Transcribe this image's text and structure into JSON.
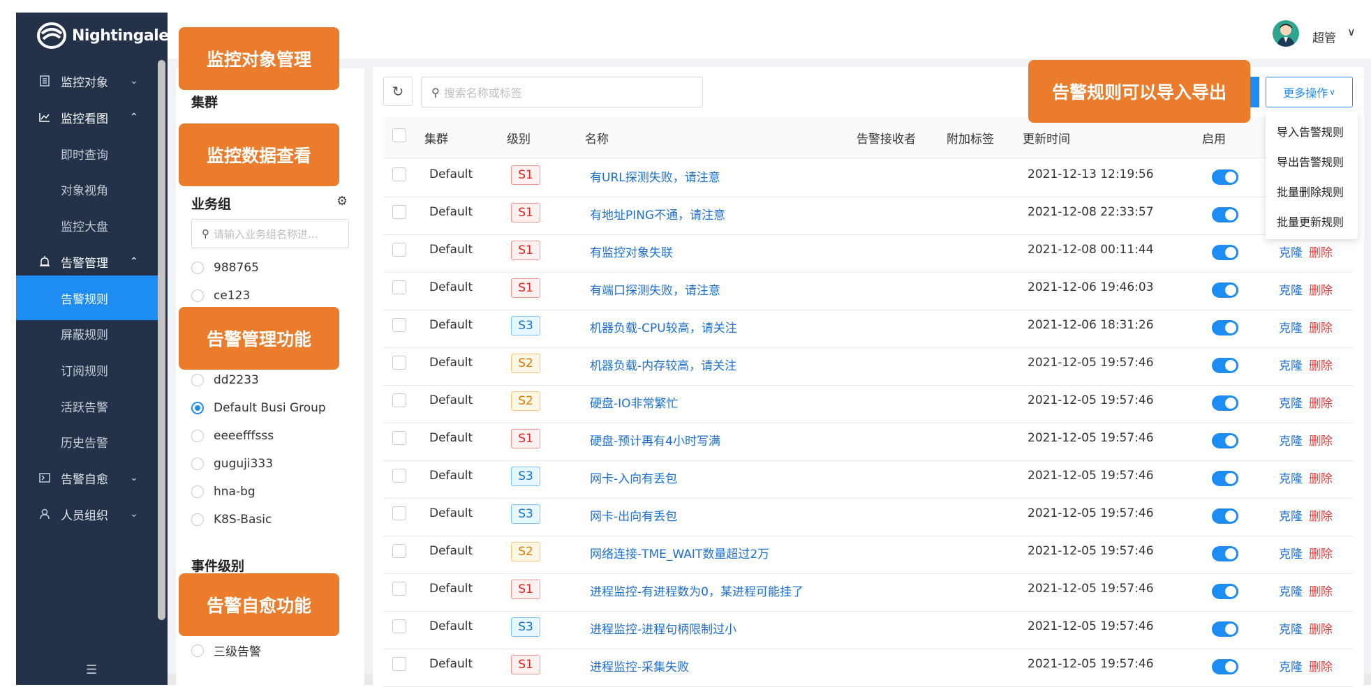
{
  "sidebar": {
    "logo_text": "Nightingale",
    "items": [
      {
        "label": "监控对象",
        "icon": "monitor-object-icon",
        "chevron": "⌄"
      },
      {
        "label": "监控看图",
        "icon": "chart-icon",
        "chevron": "⌃"
      },
      {
        "label": "即时查询"
      },
      {
        "label": "对象视角"
      },
      {
        "label": "监控大盘"
      },
      {
        "label": "告警管理",
        "icon": "alarm-icon",
        "chevron": "⌃"
      },
      {
        "label": "告警规则"
      },
      {
        "label": "屏蔽规则"
      },
      {
        "label": "订阅规则"
      },
      {
        "label": "活跃告警"
      },
      {
        "label": "历史告警"
      },
      {
        "label": "告警自愈",
        "icon": "terminal-icon",
        "chevron": "⌄"
      },
      {
        "label": "人员组织",
        "icon": "user-icon",
        "chevron": "⌄"
      }
    ],
    "active_color": "#1e8df3",
    "background": "#233249"
  },
  "header": {
    "username": "超管"
  },
  "left_panel": {
    "cluster_title": "集群",
    "busi_group_title": "业务组",
    "busi_search_placeholder": "请输入业务组名称进...",
    "groups": [
      "988765",
      "ce123",
      "dd2233",
      "Default Busi Group",
      "eeeefffsss",
      "guguji333",
      "hna-bg",
      "K8S-Basic"
    ],
    "selected_group": "Default Busi Group",
    "severity_title": "事件级别",
    "severity_visible": [
      "三级告警"
    ]
  },
  "toolbar": {
    "search_placeholder": "搜索名称或标签",
    "more_label": "更多操作",
    "more_chevron": "∨",
    "dropdown": [
      "导入告警规则",
      "导出告警规则",
      "批量删除规则",
      "批量更新规则"
    ]
  },
  "table": {
    "headers": {
      "cluster": "集群",
      "level": "级别",
      "name": "名称",
      "receivers": "告警接收者",
      "tags": "附加标签",
      "updated": "更新时间",
      "enabled": "启用"
    },
    "rows": [
      {
        "cluster": "Default",
        "level": "S1",
        "name": "有URL探测失败，请注意",
        "updated": "2021-12-13 12:19:56",
        "enabled": true
      },
      {
        "cluster": "Default",
        "level": "S1",
        "name": "有地址PING不通，请注意",
        "updated": "2021-12-08 22:33:57",
        "enabled": true
      },
      {
        "cluster": "Default",
        "level": "S1",
        "name": "有监控对象失联",
        "updated": "2021-12-08 00:11:44",
        "enabled": true
      },
      {
        "cluster": "Default",
        "level": "S1",
        "name": "有端口探测失败，请注意",
        "updated": "2021-12-06 19:46:03",
        "enabled": true
      },
      {
        "cluster": "Default",
        "level": "S3",
        "name": "机器负载-CPU较高，请关注",
        "updated": "2021-12-06 18:31:26",
        "enabled": true
      },
      {
        "cluster": "Default",
        "level": "S2",
        "name": "机器负载-内存较高，请关注",
        "updated": "2021-12-05 19:57:46",
        "enabled": true
      },
      {
        "cluster": "Default",
        "level": "S2",
        "name": "硬盘-IO非常繁忙",
        "updated": "2021-12-05 19:57:46",
        "enabled": true
      },
      {
        "cluster": "Default",
        "level": "S1",
        "name": "硬盘-预计再有4小时写满",
        "updated": "2021-12-05 19:57:46",
        "enabled": true
      },
      {
        "cluster": "Default",
        "level": "S3",
        "name": "网卡-入向有丢包",
        "updated": "2021-12-05 19:57:46",
        "enabled": true
      },
      {
        "cluster": "Default",
        "level": "S3",
        "name": "网卡-出向有丢包",
        "updated": "2021-12-05 19:57:46",
        "enabled": true
      },
      {
        "cluster": "Default",
        "level": "S2",
        "name": "网络连接-TME_WAIT数量超过2万",
        "updated": "2021-12-05 19:57:46",
        "enabled": true
      },
      {
        "cluster": "Default",
        "level": "S1",
        "name": "进程监控-有进程数为0，某进程可能挂了",
        "updated": "2021-12-05 19:57:46",
        "enabled": true
      },
      {
        "cluster": "Default",
        "level": "S3",
        "name": "进程监控-进程句柄限制过小",
        "updated": "2021-12-05 19:57:46",
        "enabled": true
      },
      {
        "cluster": "Default",
        "level": "S1",
        "name": "进程监控-采集失败",
        "updated": "2021-12-05 19:57:46",
        "enabled": true
      }
    ],
    "clone_label": "克隆",
    "delete_label": "删除"
  },
  "callouts": {
    "monitor_object": "监控对象管理",
    "monitor_data": "监控数据查看",
    "alarm_manage": "告警管理功能",
    "alarm_heal": "告警自愈功能",
    "import_export": "告警规则可以导入导出",
    "color": "#ea7c2b"
  }
}
